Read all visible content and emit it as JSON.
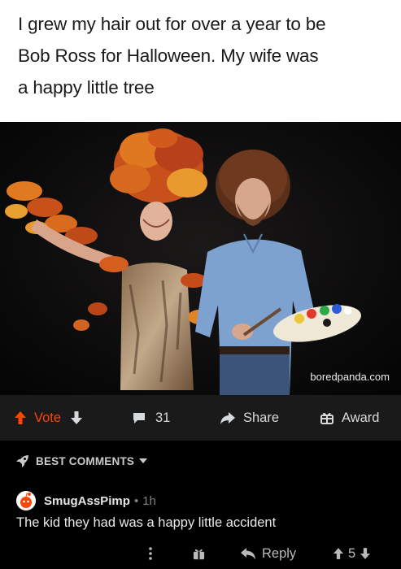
{
  "caption": {
    "line1": "I grew my hair out for over a year to be",
    "line2": "Bob Ross for Halloween. My wife was",
    "line3": "a happy little tree"
  },
  "photo": {
    "watermark": "boredpanda.com"
  },
  "action_bar": {
    "vote_label": "Vote",
    "comment_count": "31",
    "share_label": "Share",
    "award_label": "Award",
    "accent": "#ff4500"
  },
  "best_comments": {
    "label": "BEST COMMENTS"
  },
  "comment": {
    "author": "SmugAssPimp",
    "separator": "•",
    "age": "1h",
    "body": "The kid they had was a happy little accident",
    "reply_label": "Reply",
    "score": "5"
  }
}
